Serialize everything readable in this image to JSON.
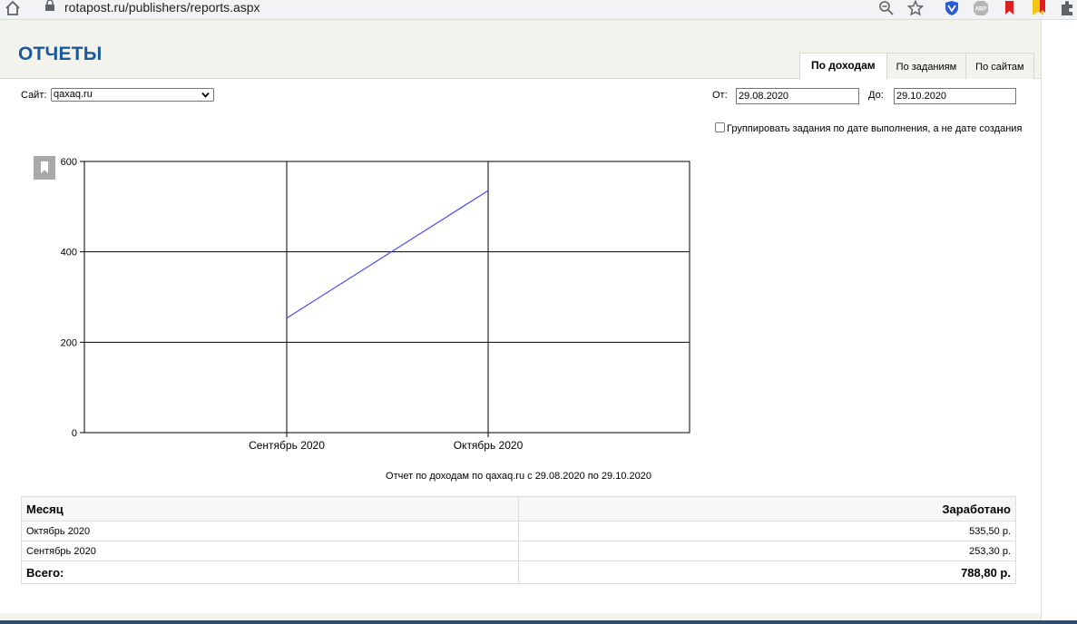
{
  "browser": {
    "url": "rotapost.ru/publishers/reports.aspx",
    "extensions": [
      "vk-shield-icon",
      "adblock-icon",
      "red-bookmark-icon",
      "yellow-bookmark-icon",
      "puzzle-icon"
    ],
    "adblock_label": "ABP"
  },
  "page": {
    "title": "ОТЧЕТЫ"
  },
  "tabs": [
    {
      "label": "По доходам",
      "active": true
    },
    {
      "label": "По заданиям",
      "active": false
    },
    {
      "label": "По сайтам",
      "active": false
    }
  ],
  "filters": {
    "site_label": "Сайт:",
    "site_value": "qaxaq.ru",
    "from_label": "От:",
    "from_value": "29.08.2020",
    "to_label": "До:",
    "to_value": "29.10.2020",
    "group_checkbox_label": "Группировать задания по дате выполнения, а не дате создания",
    "group_checked": false
  },
  "chart_data": {
    "type": "line",
    "categories": [
      "Сентябрь 2020",
      "Октябрь 2020"
    ],
    "values": [
      253.3,
      535.5
    ],
    "yticks": [
      0,
      200,
      400,
      600
    ],
    "ylim": [
      0,
      600
    ],
    "grid": true,
    "line_color": "#4b4bff"
  },
  "chart_caption": "Отчет по доходам по qaxaq.ru с 29.08.2020 по 29.10.2020",
  "table": {
    "headers": [
      "Месяц",
      "Заработано"
    ],
    "rows": [
      [
        "Октябрь 2020",
        "535,50 р."
      ],
      [
        "Сентябрь 2020",
        "253,30 р."
      ]
    ],
    "total_label": "Всего:",
    "total_value": "788,80 р."
  }
}
